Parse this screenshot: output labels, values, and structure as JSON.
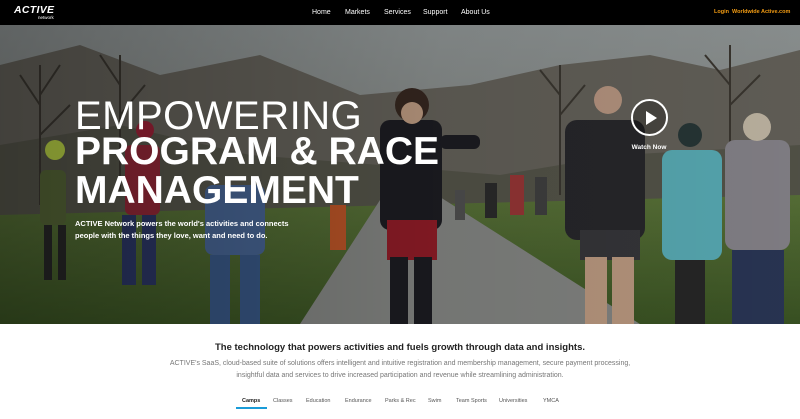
{
  "brand": {
    "logo_text": "ACTIVE",
    "logo_subtext": "network",
    "accent_color": "#f39c12",
    "tab_underline_color": "#1a9cd8"
  },
  "nav": {
    "items": [
      {
        "label": "Home"
      },
      {
        "label": "Markets"
      },
      {
        "label": "Services"
      },
      {
        "label": "Support"
      },
      {
        "label": "About Us"
      }
    ],
    "utility": [
      {
        "label": "Login"
      },
      {
        "label": "Worldwide"
      },
      {
        "label": "Active.com"
      }
    ]
  },
  "hero": {
    "line1": "EMPOWERING",
    "line2": "PROGRAM & RACE",
    "line3": "MANAGEMENT",
    "description": "ACTIVE Network powers the world's activities and connects people with the things they love, want and need to do.",
    "video_label": "Watch Now",
    "play_icon": "play-icon"
  },
  "intro": {
    "headline": "The technology that powers activities and fuels growth through data and insights.",
    "body": "ACTIVE's SaaS, cloud-based suite of solutions offers intelligent and intuitive registration and membership management, secure payment processing, insightful data and services to drive increased participation and revenue while streamlining administration."
  },
  "market_tabs": {
    "selected": "Camps",
    "items": [
      {
        "label": "Camps"
      },
      {
        "label": "Classes"
      },
      {
        "label": "Education"
      },
      {
        "label": "Endurance"
      },
      {
        "label": "Parks & Rec"
      },
      {
        "label": "Swim"
      },
      {
        "label": "Team Sports"
      },
      {
        "label": "Universities"
      },
      {
        "label": "YMCA"
      }
    ]
  }
}
